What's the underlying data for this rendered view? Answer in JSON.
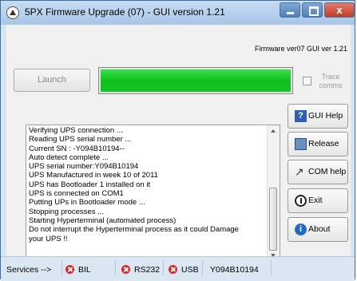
{
  "window": {
    "title": "5PX Firmware Upgrade (07) - GUI version 1.21",
    "close_label": "x"
  },
  "header": {
    "firmware_info": "Firmware ver07 GUI ver 1.21"
  },
  "launch": {
    "label": "Launch"
  },
  "progress": {
    "fraction": 1.0,
    "color": "#1ac72a"
  },
  "trace": {
    "label": "Trace comms",
    "checked": false
  },
  "log": {
    "lines": [
      "Verifying UPS connection ...",
      "Reading UPS serial number ...",
      "Current SN :  -Y094B10194--",
      "Auto detect complete ...",
      "UPS serial number:Y094B10194",
      "UPS Manufactured in week 10 of 2011",
      "UPS has Bootloader 1 installed on it",
      "UPS is connected on COM1",
      "Putting UPs in Bootloader mode ...",
      "Stopping processes ...",
      "Starting Hyperterminal (automated process)",
      "Do not interrupt the Hyperterminal process as it could Damage",
      "your UPS !!"
    ]
  },
  "side_buttons": [
    {
      "name": "gui-help-button",
      "label": "GUI Help",
      "icon": "help-book-icon"
    },
    {
      "name": "release-button",
      "label": "Release",
      "icon": "release-icon"
    },
    {
      "name": "com-help-button",
      "label": "COM help",
      "icon": "cable-plug-icon"
    },
    {
      "name": "exit-button",
      "label": "Exit",
      "icon": "power-icon"
    },
    {
      "name": "about-button",
      "label": "About",
      "icon": "info-icon"
    }
  ],
  "status": {
    "services_label": "Services -->",
    "bil": "BIL",
    "rs232": "RS232",
    "usb": "USB",
    "serial": "Y094B10194",
    "status_color": "#d42a2a"
  }
}
